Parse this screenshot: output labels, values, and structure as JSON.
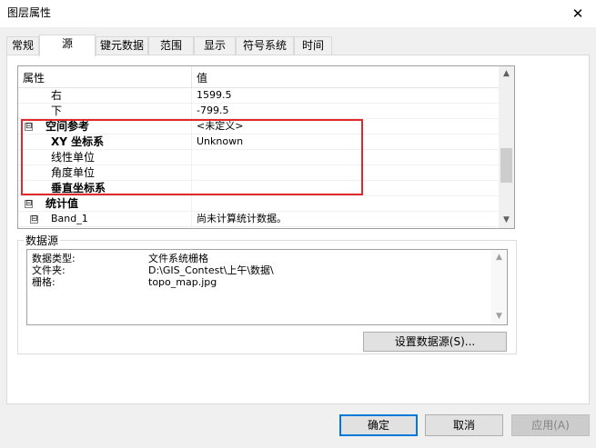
{
  "window": {
    "title": "图层属性",
    "close_glyph": "✕"
  },
  "tabs": [
    {
      "label": "常规"
    },
    {
      "label": "源"
    },
    {
      "label": "键元数据"
    },
    {
      "label": "范围"
    },
    {
      "label": "显示"
    },
    {
      "label": "符号系统"
    },
    {
      "label": "时间"
    }
  ],
  "properties": {
    "header": {
      "col1": "属性",
      "col2": "值"
    },
    "rows": [
      {
        "label": "右",
        "value": "1599.5"
      },
      {
        "label": "下",
        "value": "-799.5"
      },
      {
        "label": "空间参考",
        "value": "<未定义>",
        "expander": "⊟"
      },
      {
        "label": "XY 坐标系",
        "value": "Unknown"
      },
      {
        "label": "线性单位",
        "value": ""
      },
      {
        "label": "角度单位",
        "value": ""
      },
      {
        "label": "垂直坐标系",
        "value": ""
      },
      {
        "label": "统计值",
        "value": "",
        "expander": "⊟"
      },
      {
        "label": "Band_1",
        "value": "尚未计算统计数据。",
        "expander": "⊟"
      }
    ],
    "highlight_color": "#e0282d"
  },
  "datasource": {
    "group_label": "数据源",
    "rows": [
      {
        "key": "数据类型:",
        "value": "文件系统栅格"
      },
      {
        "key": "文件夹:",
        "value": "D:\\GIS_Contest\\上午\\数据\\"
      },
      {
        "key": "栅格:",
        "value": "topo_map.jpg"
      }
    ],
    "set_button": "设置数据源(S)..."
  },
  "footer": {
    "ok": "确定",
    "cancel": "取消",
    "apply": "应用(A)"
  },
  "colors": {
    "accent": "#0078d7"
  }
}
